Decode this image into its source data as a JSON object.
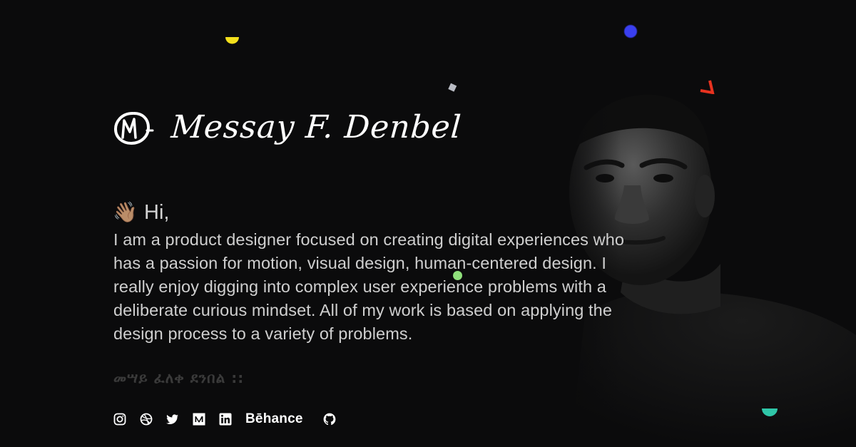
{
  "header": {
    "name": "Messay F. Denbel",
    "logo_icon": "monogram-md-icon"
  },
  "intro": {
    "wave_icon": "waving-hand-icon",
    "greeting": "Hi,",
    "bio": "I am a product designer focused on creating digital experiences who has a passion for motion, visual design, human-centered design. I really enjoy digging into complex user experience problems with a deliberate curious mindset. All of my work is based on applying the design process to a variety of problems.",
    "amharic_name": "መሣይ ፈለቀ ደንበል ::"
  },
  "social": {
    "links": [
      {
        "name": "instagram",
        "icon": "instagram-icon"
      },
      {
        "name": "dribbble",
        "icon": "dribbble-icon"
      },
      {
        "name": "twitter",
        "icon": "twitter-icon"
      },
      {
        "name": "medium",
        "icon": "medium-icon"
      },
      {
        "name": "linkedin",
        "icon": "linkedin-icon"
      },
      {
        "name": "behance",
        "label": "Bēhance"
      },
      {
        "name": "github",
        "icon": "github-icon"
      }
    ]
  },
  "colors": {
    "background": "#0b0b0c",
    "text_primary": "#ffffff",
    "text_body": "#cfcfcf",
    "accent_yellow": "#f4e01c",
    "accent_blue": "#3a3ff0",
    "accent_red": "#e8321f",
    "accent_green": "#8fe07b",
    "accent_teal": "#2fc6a8",
    "accent_gray": "#b9bcc4"
  }
}
